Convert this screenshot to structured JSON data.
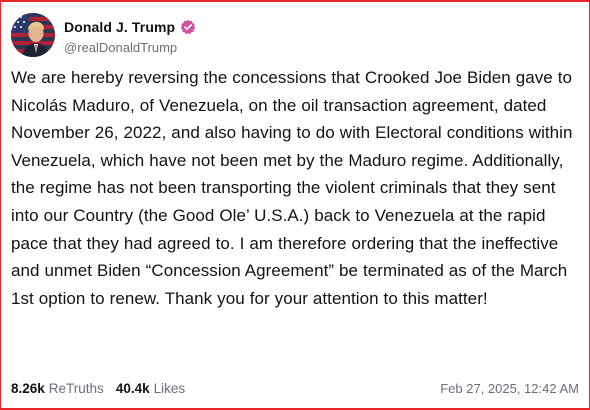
{
  "post": {
    "author": {
      "display_name": "Donald J. Trump",
      "handle": "@realDonaldTrump",
      "verified_icon": "verified-badge-icon",
      "avatar": "avatar"
    },
    "text": "We are hereby reversing the concessions that Crooked Joe Biden gave to Nicolás Maduro, of Venezuela, on the oil transaction agreement, dated November 26, 2022, and also having to do with Electoral conditions within Venezuela, which have not been met by the Maduro regime. Additionally, the regime has not been transporting the violent criminals that they sent into our Country (the Good Ole’ U.S.A.) back to Venezuela at the rapid pace that they had agreed to. I am therefore ordering that the ineffective and unmet Biden “Concession Agreement” be terminated as of the March 1st option to renew. Thank you for your attention to this matter!",
    "stats": {
      "retruths_count": "8.26k",
      "retruths_label": "ReTruths",
      "likes_count": "40.4k",
      "likes_label": "Likes"
    },
    "timestamp": "Feb 27, 2025, 12:42 AM"
  },
  "colors": {
    "frame_border": "#e8262a",
    "verified_badge": "#d64fa0",
    "text_primary": "#111318",
    "text_secondary": "#6a6f7a"
  }
}
